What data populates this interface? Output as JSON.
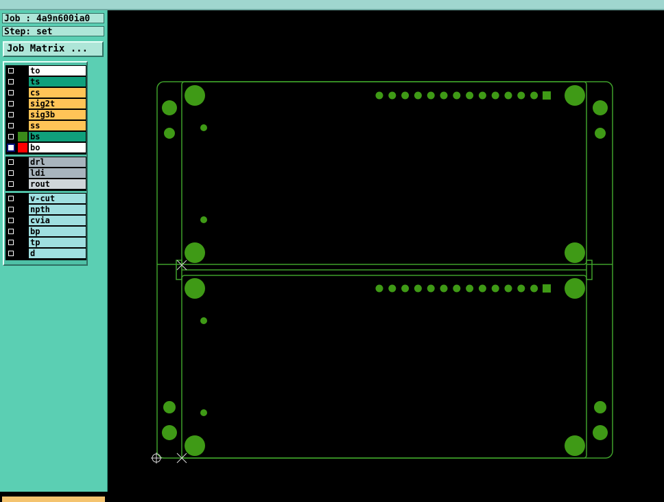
{
  "header": {
    "job": "Job : 4a9n600ia0",
    "step": "Step: set"
  },
  "buttons": {
    "job_matrix": "Job Matrix ..."
  },
  "layers": {
    "board": [
      {
        "name": "to",
        "color": "#ffffff",
        "swatch": "#000000",
        "active": false
      },
      {
        "name": "ts",
        "color": "#10a07c",
        "swatch": "#000000",
        "active": false
      },
      {
        "name": "cs",
        "color": "#ffc457",
        "swatch": "#000000",
        "active": false
      },
      {
        "name": "sig2t",
        "color": "#ffc457",
        "swatch": "#000000",
        "active": false
      },
      {
        "name": "sig3b",
        "color": "#ffc457",
        "swatch": "#000000",
        "active": false
      },
      {
        "name": "ss",
        "color": "#ffc457",
        "swatch": "#000000",
        "active": false
      },
      {
        "name": "bs",
        "color": "#10a07c",
        "swatch": "#3a8a1a",
        "active": false
      },
      {
        "name": "bo",
        "color": "#ffffff",
        "swatch": "#ff0000",
        "active": true
      }
    ],
    "drill": [
      {
        "name": "drl",
        "color": "#a8b4bd"
      },
      {
        "name": "ldi",
        "color": "#a8b4bd"
      },
      {
        "name": "rout",
        "color": "#cfd6d9"
      }
    ],
    "misc": [
      {
        "name": "v-cut",
        "color": "#9fdfe0"
      },
      {
        "name": "npth",
        "color": "#9fdfe0"
      },
      {
        "name": "cvia",
        "color": "#9fdfe0"
      },
      {
        "name": "bp",
        "color": "#9fdfe0"
      },
      {
        "name": "tp",
        "color": "#9fdfe0"
      },
      {
        "name": "d",
        "color": "#9fdfe0"
      }
    ]
  },
  "colors": {
    "outline": "#3fa02a",
    "pad": "#3f9a16",
    "sidebar": "#5bcfb3",
    "background": "#000000"
  }
}
